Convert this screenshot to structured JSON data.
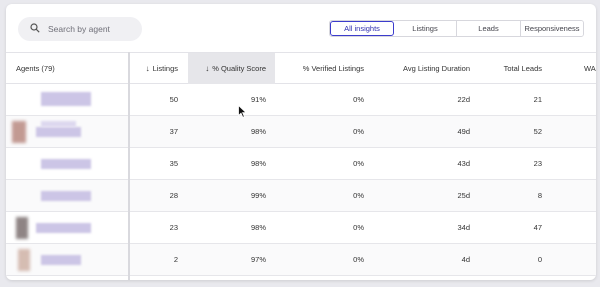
{
  "search": {
    "placeholder": "Search by agent"
  },
  "tabs": [
    {
      "label": "All insights",
      "active": true
    },
    {
      "label": "Listings",
      "active": false
    },
    {
      "label": "Leads",
      "active": false
    },
    {
      "label": "Responsiveness",
      "active": false
    }
  ],
  "table": {
    "agents_header": "Agents (79)",
    "listings_header": "Listings",
    "quality_header": "% Quality Score",
    "verified_header": "% Verified Listings",
    "duration_header": "Avg Listing Duration",
    "leads_header": "Total Leads",
    "wa_header": "WA",
    "sort_arrow": "↓",
    "rows": [
      {
        "listings": "50",
        "quality": "91%",
        "verified": "0%",
        "duration": "22d",
        "leads": "21"
      },
      {
        "listings": "37",
        "quality": "98%",
        "verified": "0%",
        "duration": "49d",
        "leads": "52"
      },
      {
        "listings": "35",
        "quality": "98%",
        "verified": "0%",
        "duration": "43d",
        "leads": "23"
      },
      {
        "listings": "28",
        "quality": "99%",
        "verified": "0%",
        "duration": "25d",
        "leads": "8"
      },
      {
        "listings": "23",
        "quality": "98%",
        "verified": "0%",
        "duration": "34d",
        "leads": "47"
      },
      {
        "listings": "2",
        "quality": "97%",
        "verified": "0%",
        "duration": "4d",
        "leads": "0"
      }
    ]
  },
  "colors": {
    "accent": "#3c3ccc",
    "sorted_header_bg": "#e6e6ea"
  }
}
